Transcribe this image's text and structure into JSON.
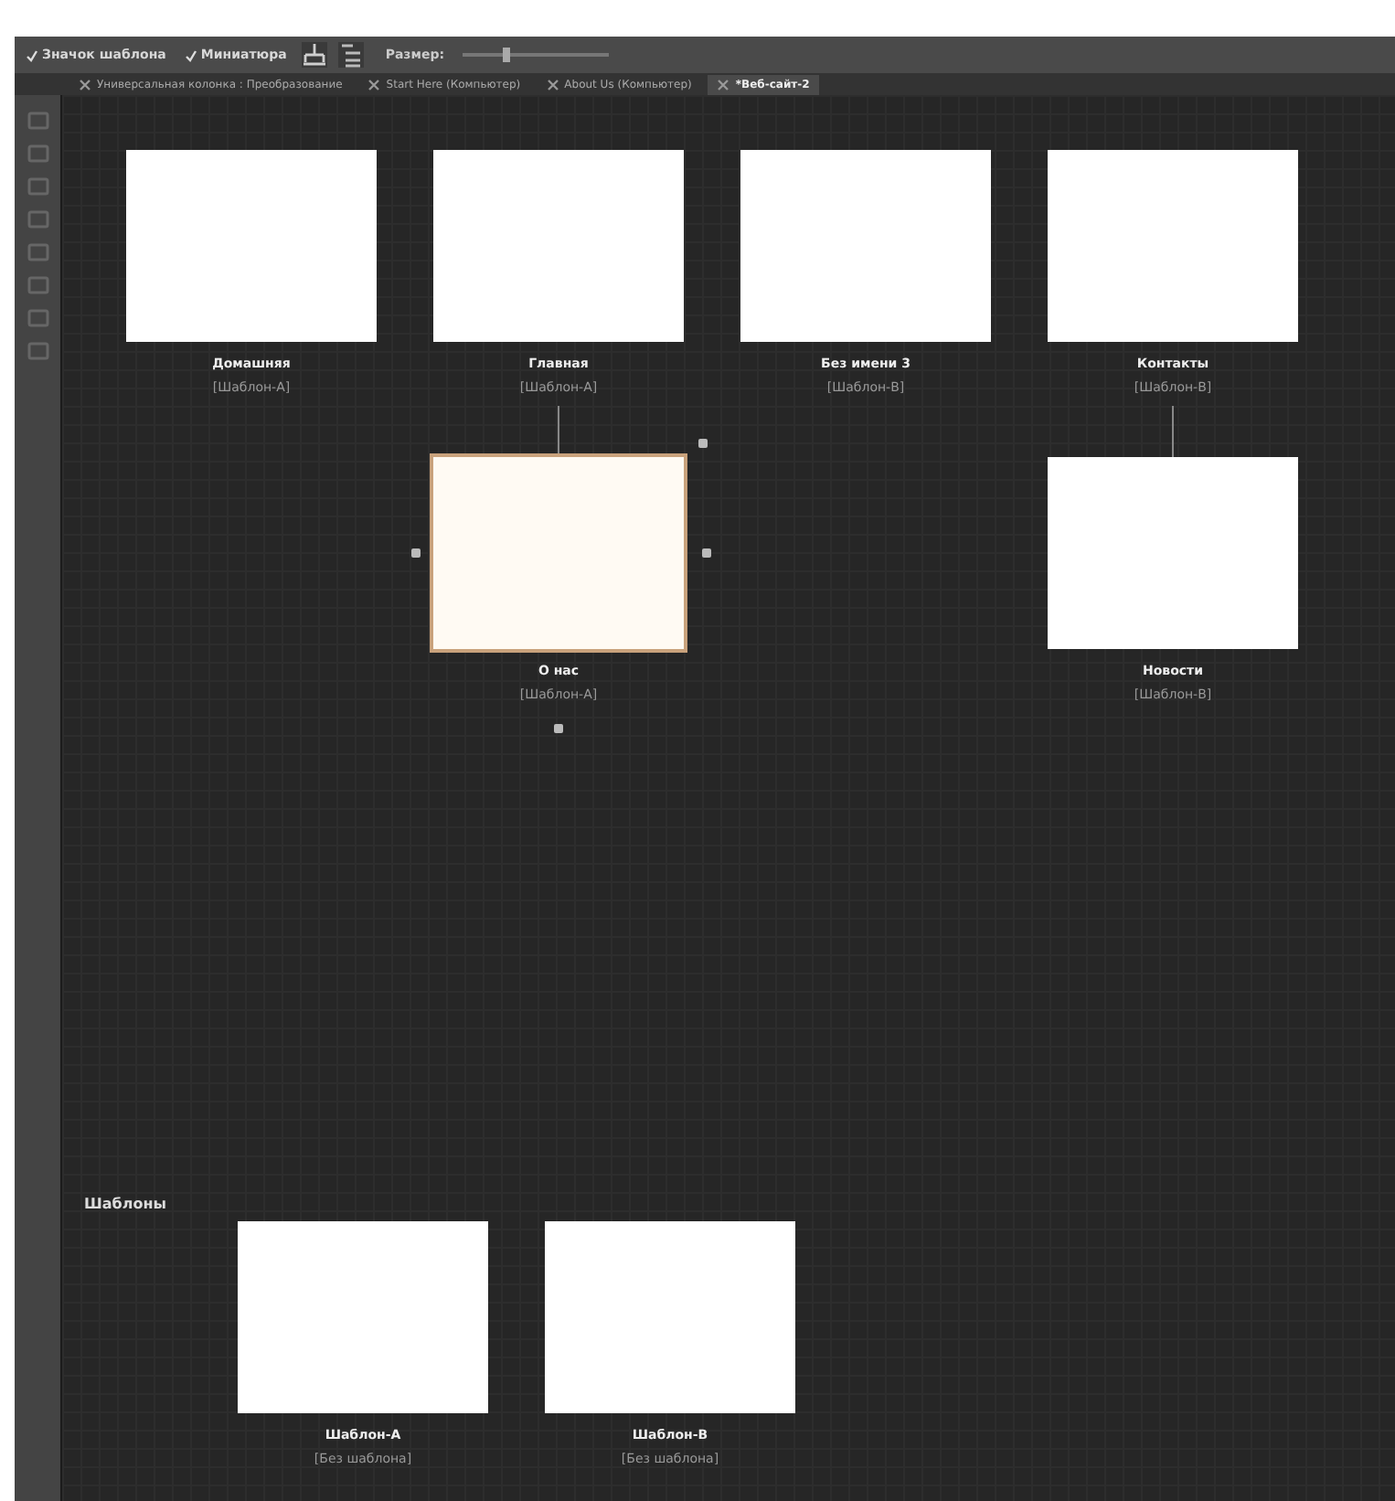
{
  "toolbar": {
    "checkboxes": [
      {
        "label": "Значок шаблона",
        "checked": true
      },
      {
        "label": "Миниатюра",
        "checked": true
      }
    ],
    "size": {
      "label": "Размер:",
      "level": 0.3
    }
  },
  "tabs": [
    {
      "label": "Универсальная колонка : Преобразование",
      "selected": false
    },
    {
      "label": "Start Here (Компьютер)",
      "selected": false
    },
    {
      "label": "About Us (Компьютер)",
      "selected": false
    },
    {
      "label": "*Веб-сайт-2",
      "selected": true
    }
  ],
  "pages": [
    {
      "name": "Домашняя",
      "template": "[Шаблон-А]",
      "selected": false
    },
    {
      "name": "Главная",
      "template": "[Шаблон-А]",
      "selected": false,
      "children": [
        {
          "name": "О нас",
          "template": "[Шаблон-А]",
          "selected": true
        }
      ]
    },
    {
      "name": "Без имени 3",
      "template": "[Шаблон-В]",
      "selected": false
    },
    {
      "name": "Контакты",
      "template": "[Шаблон-В]",
      "selected": false,
      "children": [
        {
          "name": "Новости",
          "template": "[Шаблон-В]",
          "selected": false
        }
      ]
    }
  ],
  "templates": {
    "title": "Шаблоны",
    "items": [
      {
        "name": "Шаблон-А",
        "template": "[Без шаблона]"
      },
      {
        "name": "Шаблон-В",
        "template": "[Без шаблона]"
      }
    ]
  }
}
